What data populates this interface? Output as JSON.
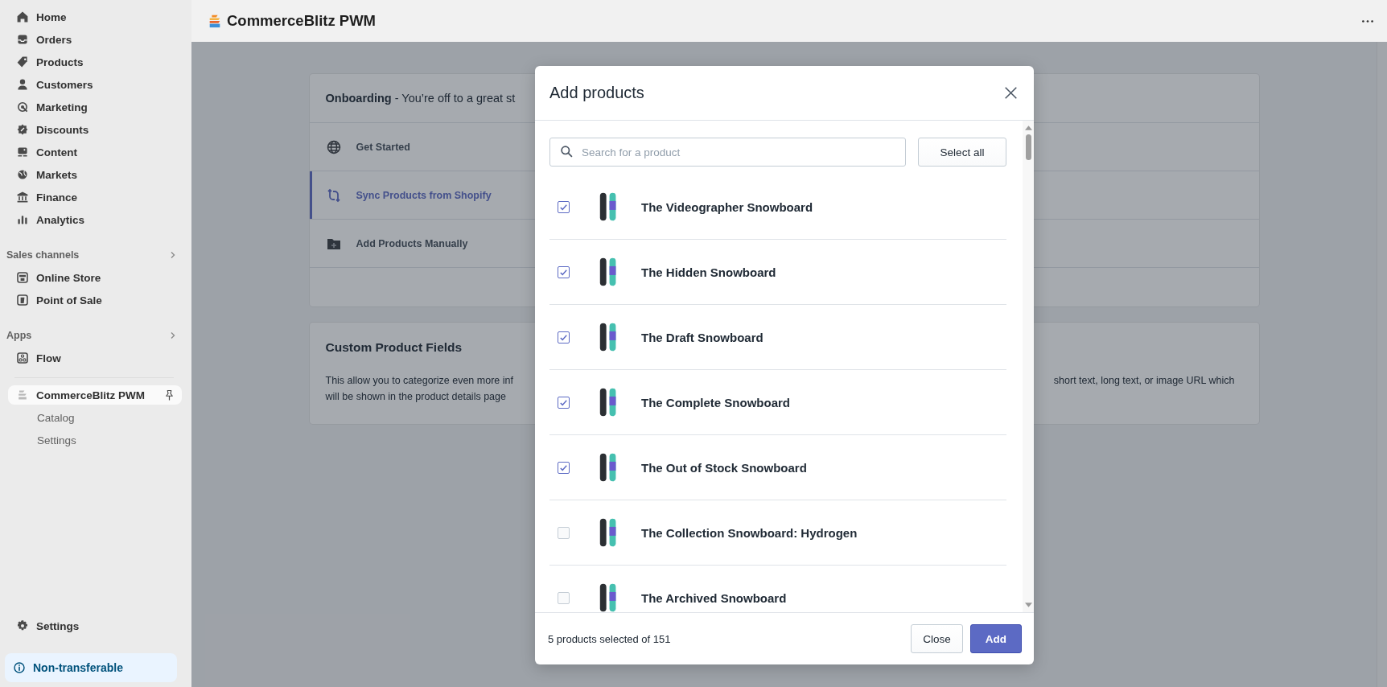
{
  "sidebar": {
    "nav": [
      {
        "label": "Home",
        "selected": false
      },
      {
        "label": "Orders",
        "selected": false
      },
      {
        "label": "Products",
        "selected": false
      },
      {
        "label": "Customers",
        "selected": false
      },
      {
        "label": "Marketing",
        "selected": false
      },
      {
        "label": "Discounts",
        "selected": false
      },
      {
        "label": "Content",
        "selected": false
      },
      {
        "label": "Markets",
        "selected": false
      },
      {
        "label": "Finance",
        "selected": false
      },
      {
        "label": "Analytics",
        "selected": false
      }
    ],
    "sales_channels": {
      "title": "Sales channels",
      "items": [
        {
          "label": "Online Store",
          "selected": false
        },
        {
          "label": "Point of Sale",
          "selected": false
        }
      ]
    },
    "apps": {
      "title": "Apps",
      "items": [
        {
          "label": "Flow",
          "selected": false
        }
      ]
    },
    "app": {
      "label": "CommerceBlitz PWM",
      "selected": true,
      "children": [
        {
          "label": "Catalog",
          "selected": false
        },
        {
          "label": "Settings",
          "selected": false
        }
      ]
    },
    "settings": {
      "label": "Settings",
      "selected": false
    },
    "notice": "Non-transferable"
  },
  "header": {
    "title": "CommerceBlitz PWM"
  },
  "onboarding": {
    "heading": "**Onboarding** - You’re off to a great st",
    "steps": [
      {
        "label": "Get Started",
        "selected": false
      },
      {
        "label": "Sync Products from Shopify",
        "selected": true
      },
      {
        "label": "Add Products Manually",
        "selected": false
      }
    ]
  },
  "custom_fields": {
    "title": "Custom Product Fields",
    "text_left": [
      "This allow you to categorize even more inf",
      "will be shown in the product details page"
    ],
    "text_right": [
      "short text, long text, or image URL which"
    ]
  },
  "modal": {
    "title": "Add products",
    "search": {
      "placeholder": "Search for a product"
    },
    "select_all": "Select all",
    "products": [
      {
        "name": "The Videographer Snowboard",
        "checked": true
      },
      {
        "name": "The Hidden Snowboard",
        "checked": true
      },
      {
        "name": "The Draft Snowboard",
        "checked": true
      },
      {
        "name": "The Complete Snowboard",
        "checked": true
      },
      {
        "name": "The Out of Stock Snowboard",
        "checked": true
      },
      {
        "name": "The Collection Snowboard: Hydrogen",
        "checked": false
      },
      {
        "name": "The Archived Snowboard",
        "checked": false
      }
    ],
    "summary": "5 products selected of 151",
    "buttons": [
      {
        "label": "Close",
        "kind": "secondary"
      },
      {
        "label": "Add",
        "kind": "primary"
      }
    ]
  }
}
